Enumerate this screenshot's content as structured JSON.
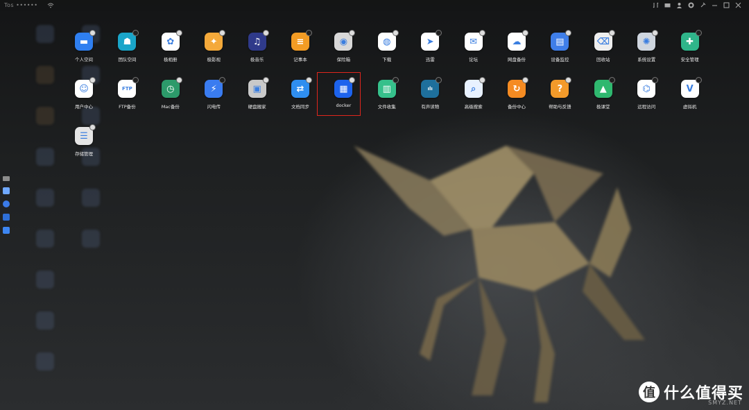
{
  "topbar": {
    "host_label": "Tos ••••••",
    "icons": [
      "transfer-icon",
      "mail-icon",
      "user-icon",
      "gear-icon",
      "pin-icon",
      "minimize-icon",
      "maximize-icon",
      "close-icon"
    ]
  },
  "apps_row1": [
    {
      "label": "个人空间",
      "icon": "folder-icon",
      "color": "#2f7ff0",
      "badge": "home"
    },
    {
      "label": "团队空间",
      "icon": "team-folder-icon",
      "color": "#1aa5c9",
      "badge": "plus"
    },
    {
      "label": "极相册",
      "icon": "photos-icon",
      "color": "#ffffff",
      "badge": "home"
    },
    {
      "label": "极影视",
      "icon": "video-icon",
      "color": "#f4a93a",
      "badge": "home"
    },
    {
      "label": "极音乐",
      "icon": "music-icon",
      "color": "#2f3a8a",
      "badge": "home"
    },
    {
      "label": "记事本",
      "icon": "notepad-icon",
      "color": "#f39c24",
      "badge": "plus"
    },
    {
      "label": "保险箱",
      "icon": "safe-icon",
      "color": "#d8d8d8",
      "badge": "home"
    },
    {
      "label": "下载",
      "icon": "download-globe-icon",
      "color": "#ffffff",
      "badge": "home"
    },
    {
      "label": "迅雷",
      "icon": "thunder-icon",
      "color": "#ffffff",
      "badge": "plus"
    },
    {
      "label": "论坛",
      "icon": "forum-icon",
      "color": "#ffffff",
      "badge": "home"
    },
    {
      "label": "网盘备份",
      "icon": "cloud-backup-icon",
      "color": "#ffffff",
      "badge": "home"
    },
    {
      "label": "设备监控",
      "icon": "monitor-chart-icon",
      "color": "#3f7ee8",
      "badge": "home"
    },
    {
      "label": "回收站",
      "icon": "trash-icon",
      "color": "#eeeeee",
      "badge": "home"
    },
    {
      "label": "系统设置",
      "icon": "settings-icon",
      "color": "#cfd6df",
      "badge": "home"
    },
    {
      "label": "安全管理",
      "icon": "shield-icon",
      "color": "#2fb58a",
      "badge": "plus"
    }
  ],
  "apps_row2": [
    {
      "label": "用户中心",
      "icon": "user-center-icon",
      "color": "#ffffff",
      "badge": "home"
    },
    {
      "label": "FTP备份",
      "icon": "ftp-icon",
      "color": "#ffffff",
      "badge": "plus"
    },
    {
      "label": "Mac备份",
      "icon": "time-machine-icon",
      "color": "#2c9a6a",
      "badge": "home"
    },
    {
      "label": "闪电传",
      "icon": "flash-transfer-icon",
      "color": "#3a7cf0",
      "badge": "plus"
    },
    {
      "label": "硬盘搬家",
      "icon": "disk-move-icon",
      "color": "#c9c9c9",
      "badge": "home"
    },
    {
      "label": "文档同步",
      "icon": "sync-doc-icon",
      "color": "#2f8ef0",
      "badge": "home"
    },
    {
      "label": "docker",
      "icon": "docker-icon",
      "color": "#1d63ed",
      "badge": "home"
    },
    {
      "label": "文件收集",
      "icon": "file-collect-icon",
      "color": "#36c08b",
      "badge": "plus"
    },
    {
      "label": "有声读物",
      "icon": "audiobook-icon",
      "color": "#1e6f9c",
      "badge": "plus"
    },
    {
      "label": "高级搜索",
      "icon": "search-icon",
      "color": "#e8f1ff",
      "badge": "home"
    },
    {
      "label": "备份中心",
      "icon": "backup-center-icon",
      "color": "#f58b22",
      "badge": "home"
    },
    {
      "label": "帮助与反馈",
      "icon": "help-icon",
      "color": "#f39a2a",
      "badge": "home"
    },
    {
      "label": "极课堂",
      "icon": "classroom-icon",
      "color": "#2fb86f",
      "badge": "plus"
    },
    {
      "label": "远程访问",
      "icon": "remote-access-icon",
      "color": "#ffffff",
      "badge": "plus"
    },
    {
      "label": "虚拟机",
      "icon": "vm-icon",
      "color": "#ffffff",
      "badge": "plus"
    }
  ],
  "apps_row3": [
    {
      "label": "存储管理",
      "icon": "storage-manager-icon",
      "color": "#e5e5e5",
      "badge": "home"
    }
  ],
  "highlighted_app": "docker",
  "watermark": {
    "glyph": "值",
    "text": "什么值得买",
    "sub": "SMYZ.NET"
  }
}
